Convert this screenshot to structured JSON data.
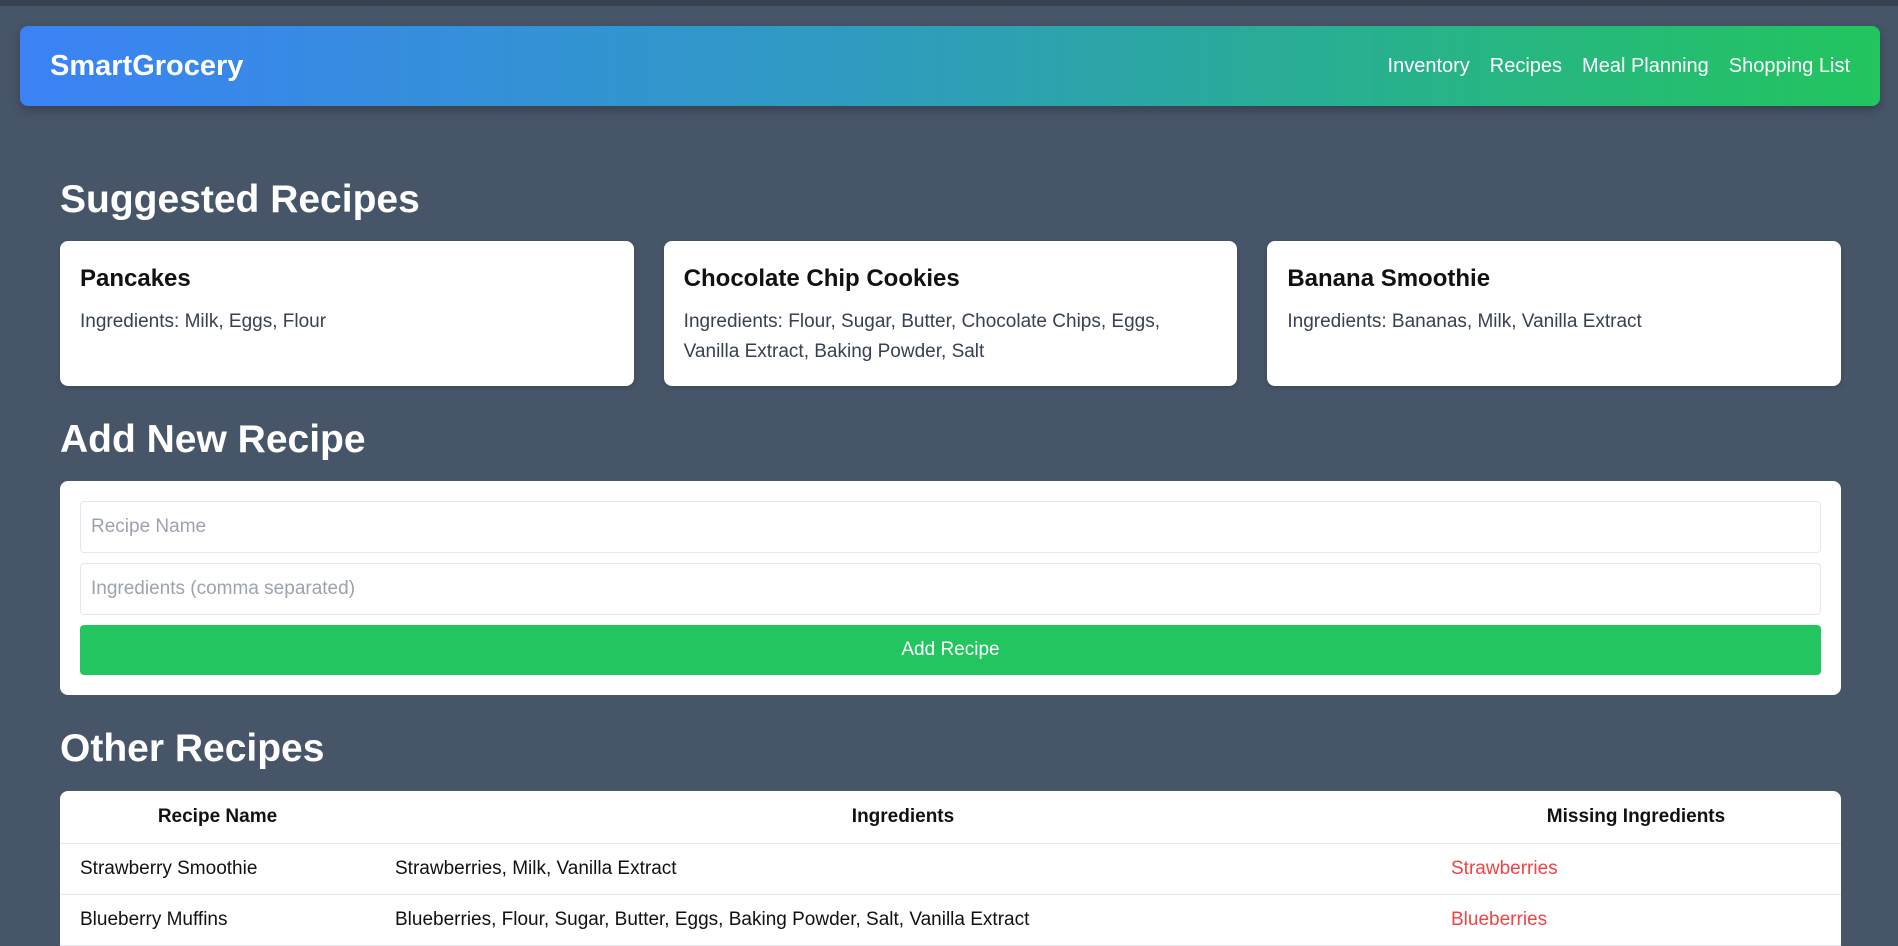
{
  "nav": {
    "brand": "SmartGrocery",
    "links": [
      "Inventory",
      "Recipes",
      "Meal Planning",
      "Shopping List"
    ]
  },
  "suggested": {
    "title": "Suggested Recipes",
    "cards": [
      {
        "name": "Pancakes",
        "ingredients": "Ingredients: Milk, Eggs, Flour"
      },
      {
        "name": "Chocolate Chip Cookies",
        "ingredients": "Ingredients: Flour, Sugar, Butter, Chocolate Chips, Eggs, Vanilla Extract, Baking Powder, Salt"
      },
      {
        "name": "Banana Smoothie",
        "ingredients": "Ingredients: Bananas, Milk, Vanilla Extract"
      }
    ]
  },
  "add_form": {
    "title": "Add New Recipe",
    "name_placeholder": "Recipe Name",
    "ingredients_placeholder": "Ingredients (comma separated)",
    "button_label": "Add Recipe"
  },
  "other": {
    "title": "Other Recipes",
    "headers": [
      "Recipe Name",
      "Ingredients",
      "Missing Ingredients"
    ],
    "rows": [
      {
        "name": "Strawberry Smoothie",
        "ingredients": "Strawberries, Milk, Vanilla Extract",
        "missing": "Strawberries"
      },
      {
        "name": "Blueberry Muffins",
        "ingredients": "Blueberries, Flour, Sugar, Butter, Eggs, Baking Powder, Salt, Vanilla Extract",
        "missing": "Blueberries"
      }
    ]
  },
  "colors": {
    "accent_green": "#22c55e",
    "accent_blue": "#3b82f6",
    "missing_red": "#ef4444",
    "background": "#475569"
  }
}
